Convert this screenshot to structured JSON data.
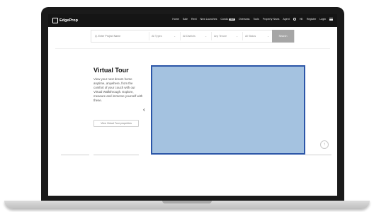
{
  "nav": {
    "logo": "EdgeProp",
    "items": [
      "Home",
      "Sale",
      "Rent",
      "New Launches",
      "Condo",
      "Overseas",
      "Tools",
      "Property News",
      "Agent"
    ],
    "condo_badge": "NEW",
    "locale": "HK",
    "register": "Register",
    "login": "Login"
  },
  "search": {
    "placeholder": "Q. Enter Project Name",
    "types": "All Types",
    "districts": "All Districts",
    "tenure": "Any Tenure",
    "status": "All Status",
    "button": "Search"
  },
  "virtual_tour": {
    "title": "Virtual Tour",
    "description": "View your next dream home anytime, anywhere, from the comfort of your couch with our Virtual Walkthrough. Explore, measure and immerse yourself with these.",
    "button": "View Virtual Tour properties"
  },
  "colors": {
    "nav_bg": "#151515",
    "preview_fill": "#a4c2e0",
    "preview_border": "#2c56a8",
    "search_button": "#a6a6a6"
  }
}
